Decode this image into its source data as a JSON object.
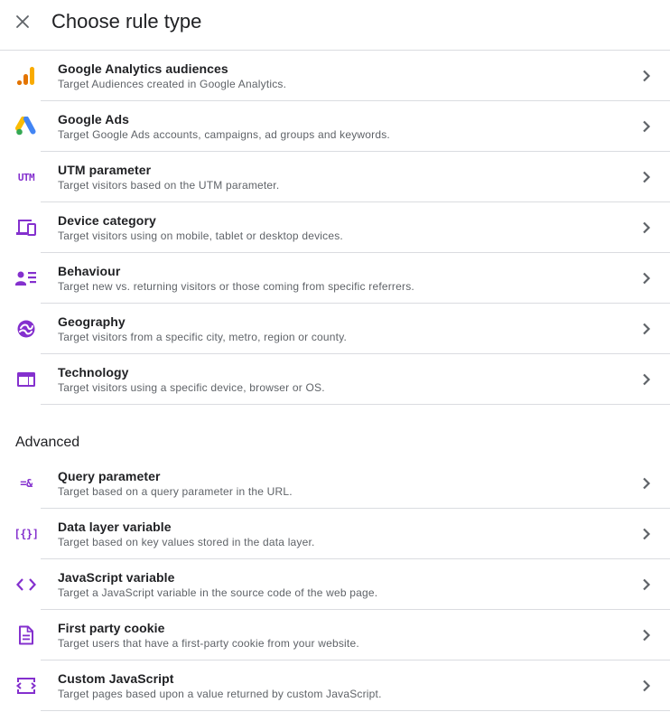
{
  "header": {
    "title": "Choose rule type"
  },
  "colors": {
    "accent": "#8430ce",
    "text_primary": "#202124",
    "text_secondary": "#5f6368",
    "divider": "#dadce0"
  },
  "rules": [
    {
      "icon": "google-analytics-icon",
      "label": "Google Analytics audiences",
      "description": "Target Audiences created in Google Analytics."
    },
    {
      "icon": "google-ads-icon",
      "label": "Google Ads",
      "description": "Target Google Ads accounts, campaigns, ad groups and keywords."
    },
    {
      "icon": "utm-icon",
      "icon_text": "UTM",
      "label": "UTM parameter",
      "description": "Target visitors based on the UTM parameter."
    },
    {
      "icon": "devices-icon",
      "label": "Device category",
      "description": "Target visitors using on mobile, tablet or desktop devices."
    },
    {
      "icon": "behaviour-icon",
      "label": "Behaviour",
      "description": "Target new vs. returning visitors or those coming from specific referrers."
    },
    {
      "icon": "geography-icon",
      "label": "Geography",
      "description": "Target visitors from a specific city, metro, region or county."
    },
    {
      "icon": "technology-icon",
      "label": "Technology",
      "description": "Target visitors using a specific device, browser or OS."
    }
  ],
  "advanced": {
    "title": "Advanced",
    "rules": [
      {
        "icon": "query-parameter-icon",
        "icon_text": "=&",
        "label": "Query parameter",
        "description": "Target based on a query parameter in the URL."
      },
      {
        "icon": "data-layer-icon",
        "icon_text": "[{}]",
        "label": "Data layer variable",
        "description": "Target based on key values stored in the data layer."
      },
      {
        "icon": "code-icon",
        "label": "JavaScript variable",
        "description": "Target a JavaScript variable in the source code of the web page."
      },
      {
        "icon": "cookie-document-icon",
        "label": "First party cookie",
        "description": "Target users that have a first-party cookie from your website."
      },
      {
        "icon": "custom-code-icon",
        "label": "Custom JavaScript",
        "description": "Target pages based upon a value returned by custom JavaScript."
      }
    ]
  }
}
